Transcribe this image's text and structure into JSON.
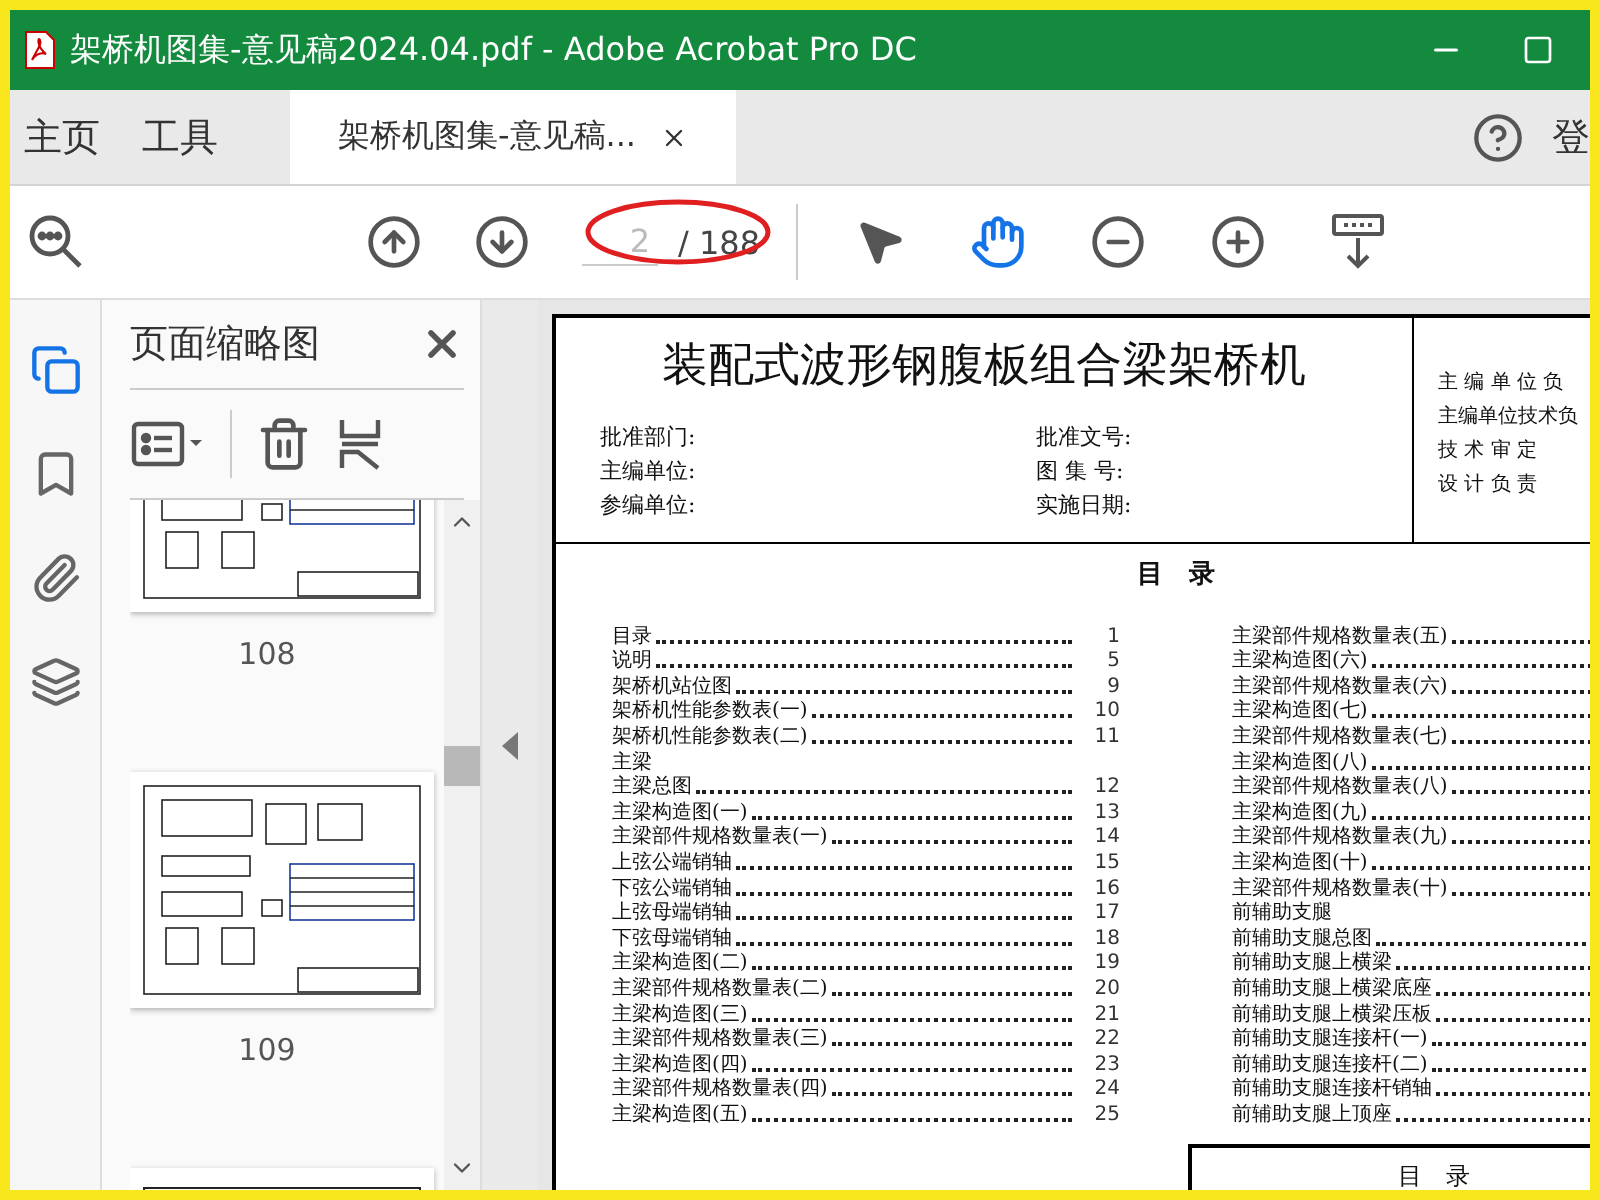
{
  "window": {
    "title": "架桥机图集-意见稿2024.04.pdf - Adobe Acrobat Pro DC"
  },
  "menu": [
    {
      "label": "主页"
    },
    {
      "label": "工具"
    }
  ],
  "document_tab": {
    "label": "架桥机图集-意见稿...",
    "selected": true
  },
  "account_button": "登",
  "toolbar": {
    "page_field": {
      "value": "2"
    },
    "page_count": "/ 188",
    "tools": [
      {
        "kind": "select",
        "selected": false
      },
      {
        "kind": "hand",
        "selected": true
      }
    ]
  },
  "rail": [
    {
      "kind": "pages",
      "selected": true
    },
    {
      "kind": "bookmarks",
      "selected": false
    },
    {
      "kind": "attachments",
      "selected": false
    },
    {
      "kind": "layers",
      "selected": false
    }
  ],
  "thumbnails_panel": {
    "title": "页面缩略图",
    "thumbnails": [
      {
        "label": "108"
      },
      {
        "label": "109"
      }
    ]
  },
  "page": {
    "title": "装配式波形钢腹板组合梁架桥机",
    "fields_left": [
      "批准部门:",
      "主编单位:",
      "参编单位:"
    ],
    "fields_right": [
      "批准文号:",
      "图 集 号:",
      "实施日期:"
    ],
    "signatures": [
      "主 编 单 位 负",
      "主编单位技术负",
      "技 术 审 定",
      "设 计 负 责"
    ],
    "toc_heading": "目　录",
    "toc_left": [
      {
        "kind": "entry",
        "title": "目录",
        "page": "1"
      },
      {
        "kind": "entry",
        "title": "说明",
        "page": "5"
      },
      {
        "kind": "entry",
        "title": "架桥机站位图",
        "page": "9"
      },
      {
        "kind": "entry",
        "title": "架桥机性能参数表(一)",
        "page": "10"
      },
      {
        "kind": "entry",
        "title": "架桥机性能参数表(二)",
        "page": "11"
      },
      {
        "kind": "heading",
        "title": "主梁"
      },
      {
        "kind": "entry",
        "title": "主梁总图",
        "page": "12"
      },
      {
        "kind": "entry",
        "title": "主梁构造图(一)",
        "page": "13"
      },
      {
        "kind": "entry",
        "title": "主梁部件规格数量表(一)",
        "page": "14"
      },
      {
        "kind": "entry",
        "title": "上弦公端销轴",
        "page": "15"
      },
      {
        "kind": "entry",
        "title": "下弦公端销轴",
        "page": "16"
      },
      {
        "kind": "entry",
        "title": "上弦母端销轴",
        "page": "17"
      },
      {
        "kind": "entry",
        "title": "下弦母端销轴",
        "page": "18"
      },
      {
        "kind": "entry",
        "title": "主梁构造图(二)",
        "page": "19"
      },
      {
        "kind": "entry",
        "title": "主梁部件规格数量表(二)",
        "page": "20"
      },
      {
        "kind": "entry",
        "title": "主梁构造图(三)",
        "page": "21"
      },
      {
        "kind": "entry",
        "title": "主梁部件规格数量表(三)",
        "page": "22"
      },
      {
        "kind": "entry",
        "title": "主梁构造图(四)",
        "page": "23"
      },
      {
        "kind": "entry",
        "title": "主梁部件规格数量表(四)",
        "page": "24"
      },
      {
        "kind": "entry",
        "title": "主梁构造图(五)",
        "page": "25"
      }
    ],
    "toc_right": [
      {
        "kind": "entry",
        "title": "主梁部件规格数量表(五)"
      },
      {
        "kind": "entry",
        "title": "主梁构造图(六)"
      },
      {
        "kind": "entry",
        "title": "主梁部件规格数量表(六)"
      },
      {
        "kind": "entry",
        "title": "主梁构造图(七)"
      },
      {
        "kind": "entry",
        "title": "主梁部件规格数量表(七)"
      },
      {
        "kind": "entry",
        "title": "主梁构造图(八)"
      },
      {
        "kind": "entry",
        "title": "主梁部件规格数量表(八)"
      },
      {
        "kind": "entry",
        "title": "主梁构造图(九)"
      },
      {
        "kind": "entry",
        "title": "主梁部件规格数量表(九)"
      },
      {
        "kind": "entry",
        "title": "主梁构造图(十)"
      },
      {
        "kind": "entry",
        "title": "主梁部件规格数量表(十)"
      },
      {
        "kind": "heading",
        "title": "前辅助支腿"
      },
      {
        "kind": "entry",
        "title": "前辅助支腿总图"
      },
      {
        "kind": "entry",
        "title": "前辅助支腿上横梁"
      },
      {
        "kind": "entry",
        "title": "前辅助支腿上横梁底座"
      },
      {
        "kind": "entry",
        "title": "前辅助支腿上横梁压板"
      },
      {
        "kind": "entry",
        "title": "前辅助支腿连接杆(一)"
      },
      {
        "kind": "entry",
        "title": "前辅助支腿连接杆(二)"
      },
      {
        "kind": "entry",
        "title": "前辅助支腿连接杆销轴"
      },
      {
        "kind": "entry",
        "title": "前辅助支腿上顶座"
      }
    ],
    "footer_title": "目　录"
  }
}
